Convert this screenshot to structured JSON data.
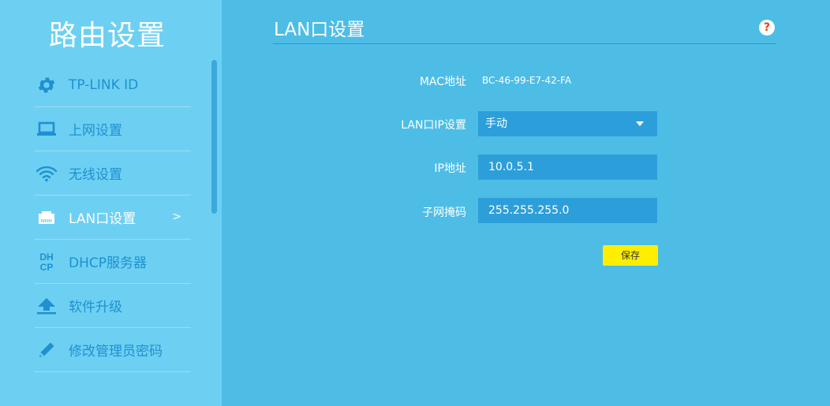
{
  "sidebar": {
    "title": "路由设置",
    "items": [
      {
        "label": "TP-LINK ID",
        "icon": "gear-icon"
      },
      {
        "label": "上网设置",
        "icon": "laptop-icon"
      },
      {
        "label": "无线设置",
        "icon": "wifi-icon"
      },
      {
        "label": "LAN口设置",
        "icon": "ethernet-port-icon",
        "arrow": ">"
      },
      {
        "label": "DHCP服务器",
        "icon": "dhcp-icon",
        "icon_text_top": "DH",
        "icon_text_bottom": "CP"
      },
      {
        "label": "软件升级",
        "icon": "upload-icon"
      },
      {
        "label": "修改管理员密码",
        "icon": "pencil-icon"
      }
    ]
  },
  "main": {
    "title": "LAN口设置",
    "help_symbol": "?",
    "form": {
      "mac_label": "MAC地址",
      "mac_value": "BC-46-99-E7-42-FA",
      "lan_ip_label": "LAN口IP设置",
      "lan_ip_mode": "手动",
      "ip_label": "IP地址",
      "ip_value": "10.0.5.1",
      "mask_label": "子网掩码",
      "mask_value": "255.255.255.0",
      "save_label": "保存"
    }
  },
  "colors": {
    "sidebar_bg": "#6dd0f2",
    "main_bg": "#4dbde6",
    "field_bg": "#2c9fdb",
    "accent_text": "#1f90d0",
    "save_button": "#ffee00"
  }
}
